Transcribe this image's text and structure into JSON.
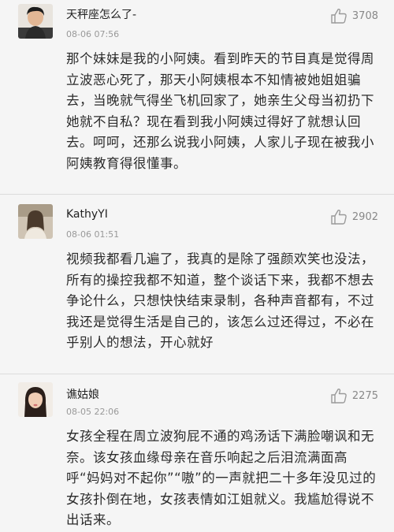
{
  "comments": [
    {
      "username": "天秤座怎么了-",
      "time": "08-06 07:56",
      "likes": "3708",
      "text": "那个妹妹是我的小阿姨。看到昨天的节目真是觉得周立波恶心死了，那天小阿姨根本不知情被她姐姐骗去，当晚就气得坐飞机回家了，她亲生父母当初扔下她就不自私？现在看到我小阿姨过得好了就想认回去。呵呵，还那么说我小阿姨，人家儿子现在被我小阿姨教育得很懂事。"
    },
    {
      "username": "KathyYI",
      "time": "08-06 01:51",
      "likes": "2902",
      "text": "视频我都看几遍了，我真的是除了强颜欢笑也没法，所有的操控我都不知道，整个谈话下来，我都不想去争论什么，只想快快结束录制，各种声音都有，不过我还是觉得生活是自己的，该怎么过还得过，不必在乎别人的想法，开心就好"
    },
    {
      "username": "谯姑娘",
      "time": "08-05 22:06",
      "likes": "2275",
      "text": "女孩全程在周立波狗屁不通的鸡汤话下满脸嘲讽和无奈。该女孩血缘母亲在音乐响起之后泪流满面高呼“妈妈对不起你”“嗷”的一声就把二十多年没见过的女孩扑倒在地，女孩表情如江姐就义。我尴尬得说不出话来。"
    }
  ],
  "icons": {
    "like": "thumbs-up-icon"
  },
  "colors": {
    "background": "#f5f5f5",
    "divider": "#dcdcdc",
    "meta": "#999999",
    "like": "#888888"
  }
}
